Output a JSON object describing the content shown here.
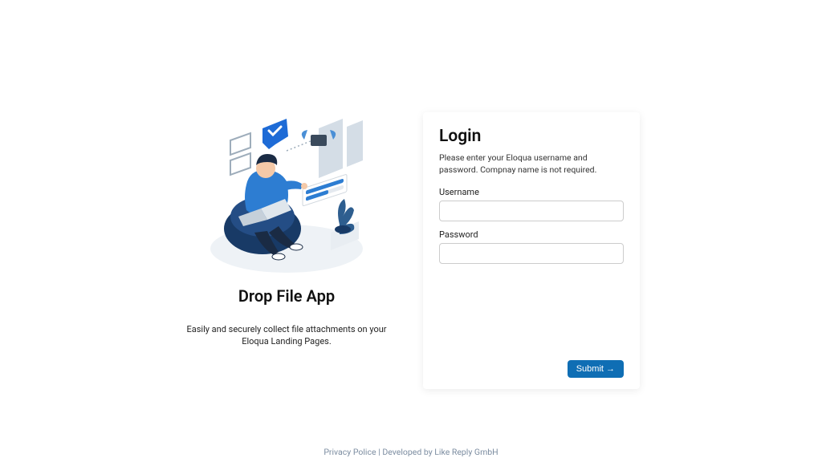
{
  "left": {
    "title": "Drop File App",
    "description": "Easily and securely collect file attachments on your Eloqua Landing Pages."
  },
  "login": {
    "heading": "Login",
    "description": "Please enter your Eloqua username and password. Compnay name is not required.",
    "username_label": "Username",
    "password_label": "Password",
    "username_value": "",
    "password_value": "",
    "submit_label": "Submit →"
  },
  "footer": {
    "privacy_label": "Privacy Police",
    "separator": " | ",
    "credit": "Developed by Like Reply GmbH"
  }
}
